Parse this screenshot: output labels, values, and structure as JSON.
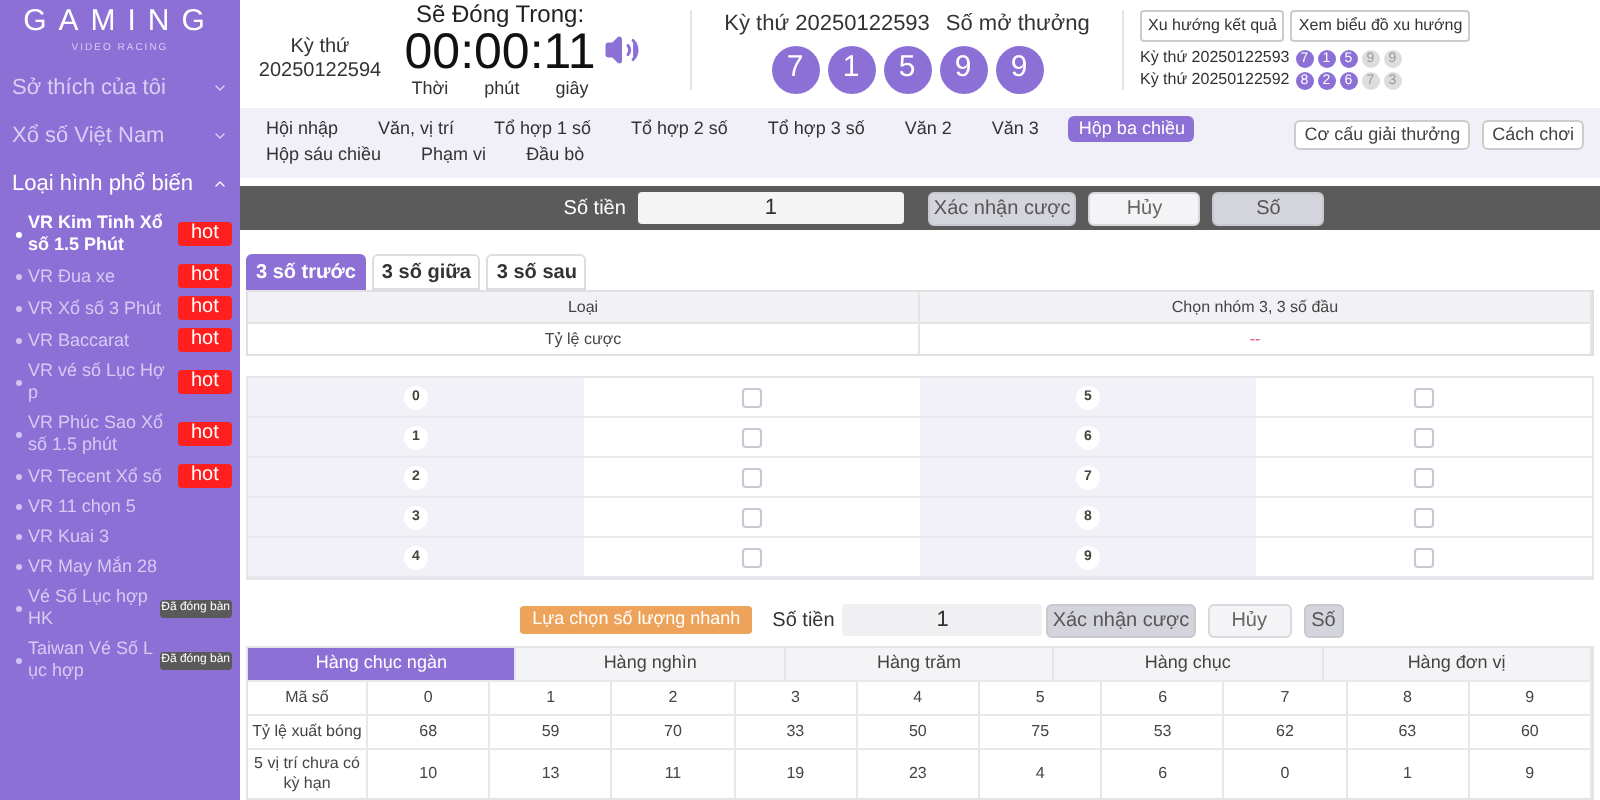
{
  "sidebar": {
    "logo": {
      "title": "GAMING",
      "subtitle": "VIDEO RACING"
    },
    "sections": [
      {
        "label": "Sở thích của tôi",
        "expanded": false
      },
      {
        "label": "Xổ số Việt Nam",
        "expanded": false
      },
      {
        "label": "Loại hình phổ biến",
        "expanded": true
      }
    ],
    "items": [
      {
        "label": "VR Kim Tinh Xổ số 1.5 Phút",
        "selected": true,
        "badge": {
          "kind": "hot",
          "text": "hot"
        }
      },
      {
        "label": "VR Đua xe",
        "selected": false,
        "badge": {
          "kind": "hot",
          "text": "hot"
        }
      },
      {
        "label": "VR Xổ số 3 Phút",
        "selected": false,
        "badge": {
          "kind": "hot",
          "text": "hot"
        }
      },
      {
        "label": "VR Baccarat",
        "selected": false,
        "badge": {
          "kind": "hot",
          "text": "hot"
        }
      },
      {
        "label": "VR vé số Lục Hợp",
        "selected": false,
        "badge": {
          "kind": "hot",
          "text": "hot"
        }
      },
      {
        "label": "VR Phúc Sao Xổ số 1.5 phút",
        "selected": false,
        "badge": {
          "kind": "hot",
          "text": "hot"
        }
      },
      {
        "label": "VR Tecent Xổ số",
        "selected": false,
        "badge": {
          "kind": "hot",
          "text": "hot"
        }
      },
      {
        "label": "VR 11 chọn 5",
        "selected": false
      },
      {
        "label": "VR Kuai 3",
        "selected": false
      },
      {
        "label": "VR May Mắn 28",
        "selected": false
      },
      {
        "label": "Vé Số Lục hợp HK",
        "selected": false,
        "badge": {
          "kind": "closed",
          "text": "Đã đóng bàn"
        }
      },
      {
        "label": "Taiwan Vé Số Lục hợp",
        "selected": false,
        "badge": {
          "kind": "closed",
          "text": "Đã đóng bàn"
        }
      }
    ]
  },
  "header": {
    "current": {
      "label": "Kỳ thứ",
      "issue": "20250122594"
    },
    "countdown": {
      "title": "Sẽ Đóng Trong:",
      "time": "00:00:11",
      "units": [
        "Thời",
        "phút",
        "giây"
      ]
    },
    "last": {
      "label": "Kỳ thứ 20250122593",
      "result_label": "Số mở thưởng",
      "balls": [
        "7",
        "1",
        "5",
        "9",
        "9"
      ]
    },
    "buttons": [
      "Xu hướng kết quả",
      "Xem biểu đồ xu hướng"
    ],
    "history": [
      {
        "label": "Kỳ thứ 20250122593",
        "balls": [
          {
            "value": "7",
            "highlighted": true
          },
          {
            "value": "1",
            "highlighted": true
          },
          {
            "value": "5",
            "highlighted": true
          },
          {
            "value": "9",
            "highlighted": false
          },
          {
            "value": "9",
            "highlighted": false
          }
        ]
      },
      {
        "label": "Kỳ thứ 20250122592",
        "balls": [
          {
            "value": "8",
            "highlighted": true
          },
          {
            "value": "2",
            "highlighted": true
          },
          {
            "value": "6",
            "highlighted": true
          },
          {
            "value": "7",
            "highlighted": false
          },
          {
            "value": "3",
            "highlighted": false
          }
        ]
      }
    ]
  },
  "nav": {
    "tabs": [
      {
        "label": "Hội nhập",
        "selected": false
      },
      {
        "label": "Văn, vị trí",
        "selected": false
      },
      {
        "label": "Tổ hợp 1 số",
        "selected": false
      },
      {
        "label": "Tổ hợp 2 số",
        "selected": false
      },
      {
        "label": "Tổ hợp 3 số",
        "selected": false
      },
      {
        "label": "Văn 2",
        "selected": false
      },
      {
        "label": "Văn 3",
        "selected": false
      },
      {
        "label": "Hộp ba chiều",
        "selected": true
      },
      {
        "label": "Hộp sáu chiều",
        "selected": false
      },
      {
        "label": "Phạm vi",
        "selected": false
      },
      {
        "label": "Đầu bò",
        "selected": false
      }
    ],
    "buttons": [
      "Cơ cấu giải thưởng",
      "Cách chơi"
    ]
  },
  "bet_bar": {
    "label": "Số tiền",
    "value": "1",
    "buttons": [
      {
        "label": "Xác nhận cược",
        "kind": "confirm"
      },
      {
        "label": "Hủy",
        "kind": "cancel"
      },
      {
        "label": "Số",
        "kind": "number"
      }
    ]
  },
  "subtabs": [
    {
      "label": "3 số trước",
      "selected": true
    },
    {
      "label": "3 số giữa",
      "selected": false
    },
    {
      "label": "3 số sau",
      "selected": false
    }
  ],
  "odds_table": {
    "columns": [
      "Loại",
      "Chọn nhóm 3, 3 số đầu"
    ],
    "row": [
      "Tỷ lệ cược",
      "--"
    ]
  },
  "number_grid": [
    {
      "number": "0",
      "checked": false
    },
    {
      "number": "1",
      "checked": false
    },
    {
      "number": "2",
      "checked": false
    },
    {
      "number": "3",
      "checked": false
    },
    {
      "number": "4",
      "checked": false
    },
    {
      "number": "5",
      "checked": false
    },
    {
      "number": "6",
      "checked": false
    },
    {
      "number": "7",
      "checked": false
    },
    {
      "number": "8",
      "checked": false
    },
    {
      "number": "9",
      "checked": false
    }
  ],
  "quick_bar": {
    "quick_button": "Lựa chọn số lượng nhanh",
    "label": "Số tiền",
    "value": "1",
    "buttons": [
      {
        "label": "Xác nhận cược",
        "kind": "confirm"
      },
      {
        "label": "Hủy",
        "kind": "cancel"
      },
      {
        "label": "Số",
        "kind": "number"
      }
    ]
  },
  "stats": {
    "tabs": [
      {
        "label": "Hàng chục ngàn",
        "selected": true
      },
      {
        "label": "Hàng nghìn",
        "selected": false
      },
      {
        "label": "Hàng trăm",
        "selected": false
      },
      {
        "label": "Hàng chục",
        "selected": false
      },
      {
        "label": "Hàng đơn vị",
        "selected": false
      }
    ],
    "rows": [
      {
        "header": "Mã số",
        "cells": [
          "0",
          "1",
          "2",
          "3",
          "4",
          "5",
          "6",
          "7",
          "8",
          "9"
        ]
      },
      {
        "header": "Tỷ lệ xuất bóng",
        "cells": [
          "68",
          "59",
          "70",
          "33",
          "50",
          "75",
          "53",
          "62",
          "63",
          "60"
        ]
      },
      {
        "header": "5 vị trí chưa có kỳ hạn",
        "cells": [
          "10",
          "13",
          "11",
          "19",
          "23",
          "4",
          "6",
          "0",
          "1",
          "9"
        ]
      }
    ]
  }
}
